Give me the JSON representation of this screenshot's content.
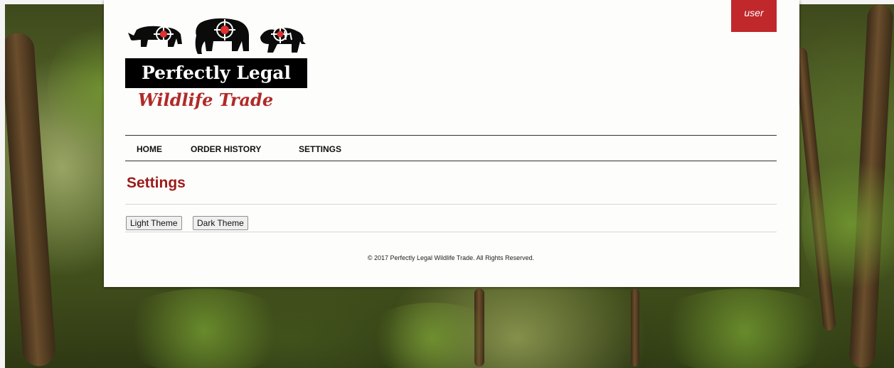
{
  "header": {
    "user_label": "user",
    "logo_title": "Perfectly Legal",
    "logo_subtitle": "Wildlife Trade"
  },
  "nav": {
    "items": [
      {
        "label": "HOME"
      },
      {
        "label": "ORDER HISTORY"
      },
      {
        "label": "SETTINGS"
      }
    ]
  },
  "main": {
    "title": "Settings",
    "buttons": {
      "light_theme": "Light Theme",
      "dark_theme": "Dark Theme"
    }
  },
  "footer": {
    "text": "© 2017 Perfectly Legal Wildlife Trade. All Rights Reserved."
  },
  "colors": {
    "accent_red": "#c0282c",
    "title_red": "#9b1b1b",
    "logo_red": "#b02a28",
    "panel_bg": "#fdfdfb",
    "target_red": "#e03030"
  },
  "icons": {
    "logo_animals": [
      "rhino-icon",
      "elephant-icon",
      "tiger-icon",
      "crosshair-icon"
    ]
  }
}
